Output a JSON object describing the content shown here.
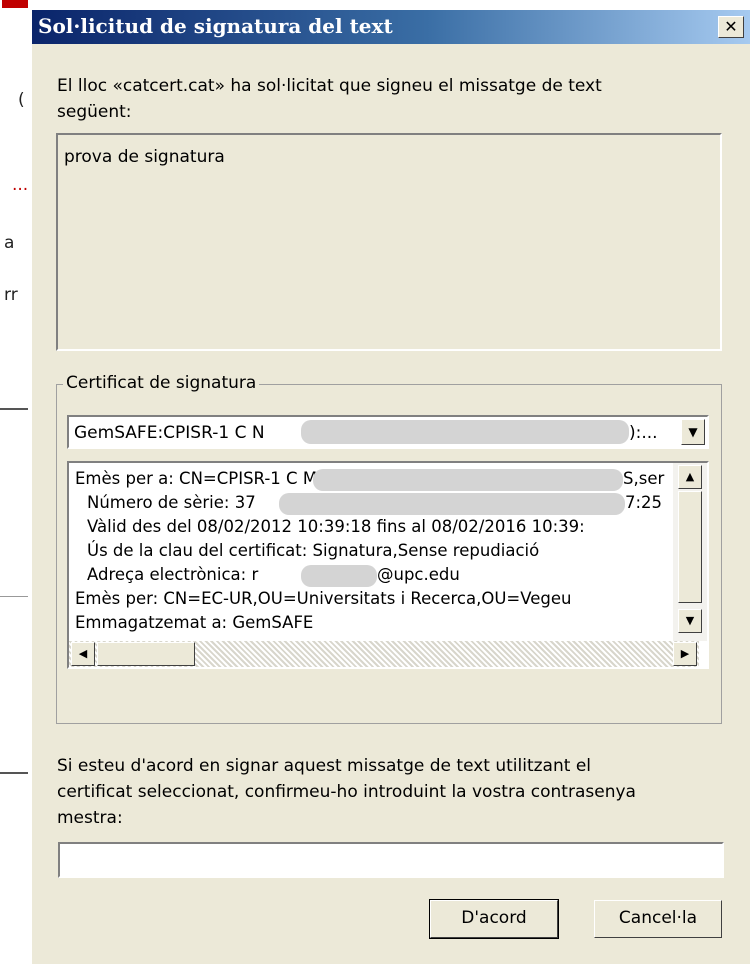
{
  "background": {
    "fragments": [
      "(",
      "...",
      "a",
      "rr"
    ]
  },
  "dialog": {
    "title": "Sol·licitud de signatura del text",
    "close_glyph": "✕",
    "intro_line1": "El lloc «catcert.cat» ha sol·licitat que signeu el missatge de text",
    "intro_line2": "següent:",
    "message_text": "prova de signatura",
    "cert_group": {
      "legend": "Certificat de signatura",
      "selected": "GemSAFE:CPISR-1 C N",
      "selected_suffix": "):...",
      "details": {
        "issued_to": "Emès per a: CN=CPISR-1 C M",
        "issued_to_suffix": "S,ser",
        "serial": "Número de sèrie: 37",
        "serial_suffix": "7:25",
        "valid": "Vàlid des del 08/02/2012 10:39:18 fins al 08/02/2016 10:39:",
        "key_usage": "Ús de la clau del certificat: Signatura,Sense repudiació",
        "email": "Adreça electrònica: r",
        "email_suffix": "@upc.edu",
        "issued_by": "Emès per: CN=EC-UR,OU=Universitats i Recerca,OU=Vegeu",
        "stored": "Emmagatzemat a: GemSAFE"
      }
    },
    "confirm_line1": "Si esteu d'acord en signar aquest missatge de text utilitzant el",
    "confirm_line2": "certificat seleccionat, confirmeu-ho introduint la vostra contrasenya",
    "confirm_line3": "mestra:",
    "password_value": "",
    "ok_label": "D'acord",
    "cancel_label": "Cancel·la",
    "colors": {
      "title_start": "#0a246a",
      "title_end": "#a6caf0",
      "face": "#ece9d8"
    }
  }
}
